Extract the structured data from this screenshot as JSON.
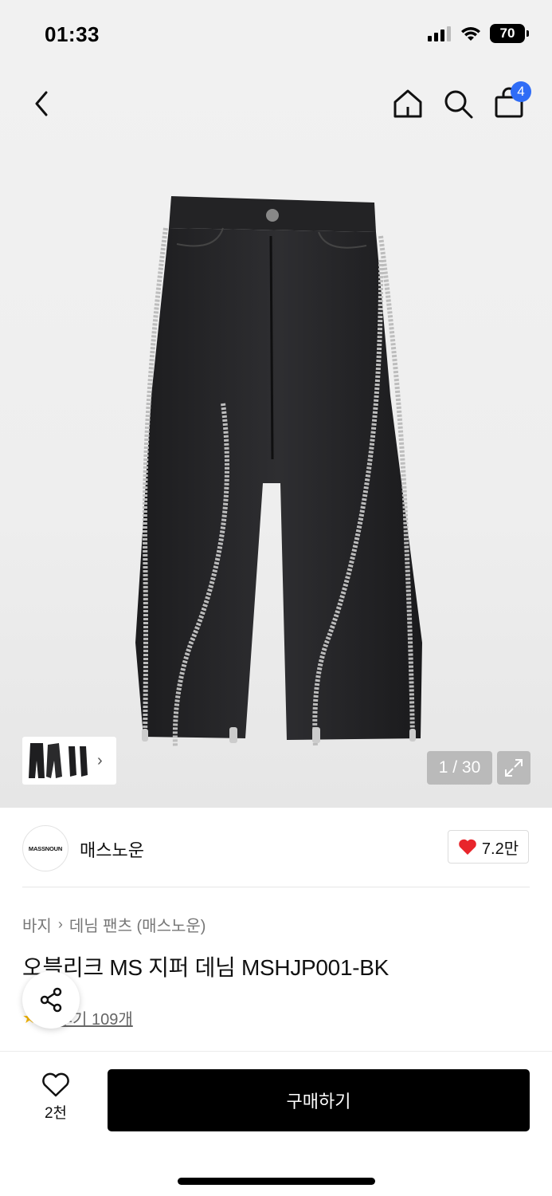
{
  "status_bar": {
    "time": "01:33",
    "battery": "70"
  },
  "nav": {
    "back_icon": "chevron-left-icon",
    "home_icon": "home-icon",
    "search_icon": "search-icon",
    "bag_icon": "shopping-bag-icon",
    "bag_count": "4"
  },
  "gallery": {
    "counter": "1 / 30",
    "expand_icon": "expand-icon",
    "thumbnail_chevron": "›"
  },
  "brand": {
    "logo_text": "MASSNOUN",
    "name": "매스노운",
    "likes": "7.2만",
    "heart_color": "#e8252b"
  },
  "breadcrumb": {
    "category": "바지",
    "separator": "›",
    "subcategory": "데님 팬츠 (매스노운)"
  },
  "product": {
    "title": "오블리크 MS 지퍼 데님 MSHJP001-BK",
    "rating_stars": "★",
    "rating_value": "5",
    "reviews": "후기 109개"
  },
  "bottom": {
    "wish_count": "2천",
    "buy_label": "구매하기"
  },
  "colors": {
    "badge": "#2f6cf6",
    "buy_button": "#000000",
    "star": "#f4b400"
  }
}
